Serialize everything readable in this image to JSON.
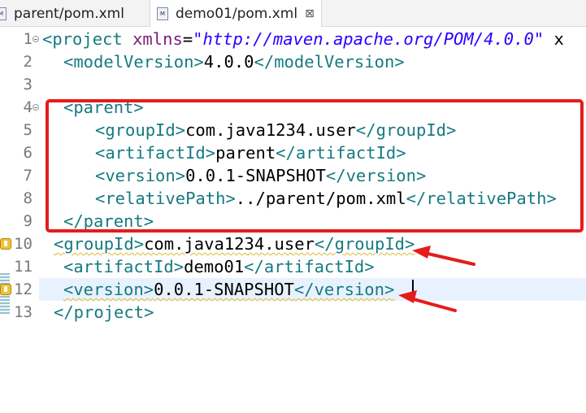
{
  "tabs": [
    {
      "label": "parent/pom.xml",
      "icon": "maven-file-icon",
      "icon_letter": "M"
    },
    {
      "label": "demo01/pom.xml",
      "icon": "maven-file-icon",
      "icon_letter": "M",
      "close": "⊠"
    }
  ],
  "lines": [
    {
      "n": "1",
      "t1": "<project ",
      "a": "xmlns",
      "eq": "=",
      "v": "\"http://maven.apache.org/POM/4.0.0\"",
      "tail": " x"
    },
    {
      "n": "2",
      "open": "<modelVersion>",
      "text": "4.0.0",
      "close": "</modelVersion>"
    },
    {
      "n": "3"
    },
    {
      "n": "4",
      "open": "<parent>"
    },
    {
      "n": "5",
      "open": "<groupId>",
      "text": "com.java1234.user",
      "close": "</groupId>"
    },
    {
      "n": "6",
      "open": "<artifactId>",
      "text": "parent",
      "close": "</artifactId>"
    },
    {
      "n": "7",
      "open": "<version>",
      "text": "0.0.1-SNAPSHOT",
      "close": "</version>"
    },
    {
      "n": "8",
      "open": "<relativePath>",
      "text": "../parent/pom.xml",
      "close": "</relativePath>"
    },
    {
      "n": "9",
      "open": "</parent>"
    },
    {
      "n": "10",
      "open": "<groupId>",
      "text": "com.java1234.user",
      "close": "</groupId>"
    },
    {
      "n": "11",
      "open": "<artifactId>",
      "text": "demo01",
      "close": "</artifactId>"
    },
    {
      "n": "12",
      "open": "<version>",
      "text": "0.0.1-SNAPSHOT",
      "close": "</version>"
    },
    {
      "n": "13",
      "open": "</project>"
    }
  ],
  "colors": {
    "tag": "#167a80",
    "attribute": "#7a1e7a",
    "value": "#2a00ff",
    "annotation": "#e51c1c",
    "current_line": "#e8f2fe"
  }
}
